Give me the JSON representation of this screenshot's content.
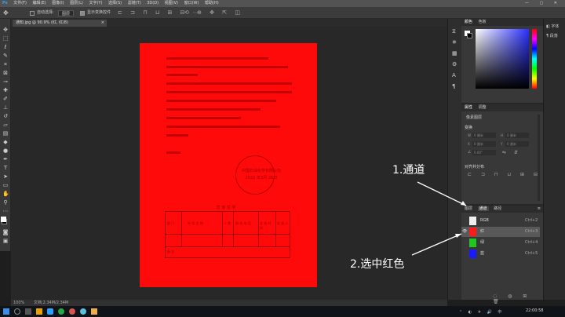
{
  "menubar": {
    "items": [
      "文件(F)",
      "编辑(E)",
      "图像(I)",
      "图层(L)",
      "文字(Y)",
      "选择(S)",
      "滤镜(T)",
      "3D(D)",
      "视图(V)",
      "窗口(W)",
      "帮助(H)"
    ]
  },
  "options_bar": {
    "auto_select_label": "自动选择:",
    "auto_select_value": "图层",
    "transform_label": "显示变换控件"
  },
  "document_tab": {
    "title": "通知.jpg @ 90.9% (红, 红/8)"
  },
  "document_text": {
    "stamp_line1": "中国石油化学有限公司",
    "stamp_line2": "2021 年3月 26日",
    "table_title": "发 放 说 明",
    "table_col1": "部 门",
    "table_col2": "单 位 名 称",
    "table_col3": "人 数",
    "table_col4": "联 系 电 话",
    "table_col5": "发 放 时 间",
    "table_col6": "发 放 人",
    "table_note": "备 注"
  },
  "right_panel": {
    "color_tab": "颜色",
    "swatch_tab": "色板",
    "properties_tab": "属性",
    "adjust_tab": "调整",
    "pixel_layer": "像素图层",
    "transform_label": "变换",
    "align_label": "对齐并分布",
    "w_label": "W",
    "h_label": "H",
    "x_label": "X",
    "y_label": "Y",
    "w_value": "0 厘米",
    "h_value": "0 厘米",
    "x_value": "0 厘米",
    "y_value": "0 厘米",
    "angle_value": "0.00°",
    "layers_tab": "图层",
    "channels_tab": "通道",
    "paths_tab": "路径"
  },
  "channels": [
    {
      "name": "RGB",
      "key": "Ctrl+2",
      "color": "#eeeeee",
      "selected": false,
      "visible": false
    },
    {
      "name": "红",
      "key": "Ctrl+3",
      "color": "#ff1a1a",
      "selected": true,
      "visible": true
    },
    {
      "name": "绿",
      "key": "Ctrl+4",
      "color": "#1ec81e",
      "selected": false,
      "visible": false
    },
    {
      "name": "蓝",
      "key": "Ctrl+5",
      "color": "#1a1aff",
      "selected": false,
      "visible": false
    }
  ],
  "annotations": {
    "step1": "1.通道",
    "step2": "2.选中红色"
  },
  "status_bar": {
    "zoom": "100%",
    "doc_size": "文档:2.34M/2.34M"
  },
  "taskbar": {
    "time": "22:00:58"
  },
  "icons": [
    "move-icon",
    "marquee-icon",
    "lasso-icon",
    "quick-select-icon",
    "crop-icon",
    "eyedropper-icon",
    "healing-icon",
    "brush-icon",
    "stamp-icon",
    "history-brush-icon",
    "eraser-icon",
    "gradient-icon",
    "blur-icon",
    "dodge-icon",
    "pen-icon",
    "type-icon",
    "path-select-icon",
    "shape-icon",
    "hand-icon",
    "zoom-icon"
  ]
}
